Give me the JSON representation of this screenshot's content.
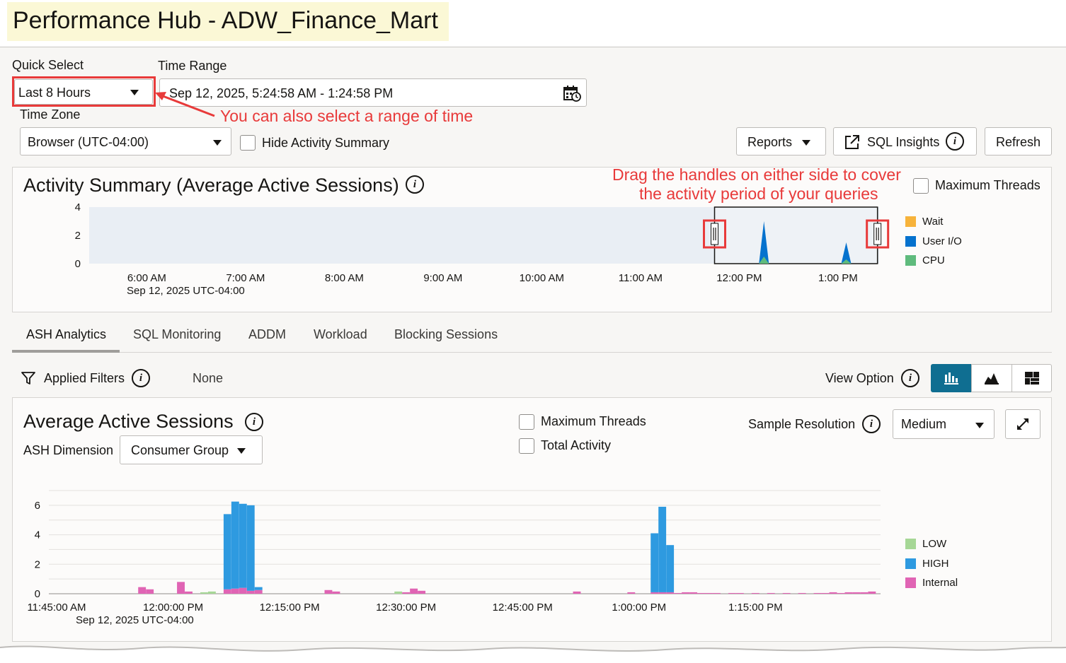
{
  "header": {
    "title": "Performance Hub - ADW_Finance_Mart"
  },
  "controls": {
    "quick_select_label": "Quick Select",
    "quick_select_value": "Last 8 Hours",
    "time_range_label": "Time Range",
    "time_range_value": "Sep 12, 2025, 5:24:58 AM - 1:24:58 PM",
    "time_zone_label": "Time Zone",
    "time_zone_value": "Browser (UTC-04:00)",
    "hide_activity_label": "Hide Activity Summary",
    "reports_label": "Reports",
    "sql_insights_label": "SQL Insights",
    "refresh_label": "Refresh"
  },
  "annotations": {
    "range_note": "You can also select a range of time",
    "drag_note_1": "Drag the handles on either side to cover",
    "drag_note_2": "the activity period of your queries"
  },
  "activity": {
    "title": "Activity Summary (Average Active Sessions)",
    "max_threads_label": "Maximum Threads",
    "date_label": "Sep 12, 2025 UTC-04:00",
    "legend": [
      {
        "name": "Wait",
        "color": "#f7b33b"
      },
      {
        "name": "User I/O",
        "color": "#0572ce"
      },
      {
        "name": "CPU",
        "color": "#5fbb7d"
      }
    ]
  },
  "tabs": [
    "ASH Analytics",
    "SQL Monitoring",
    "ADDM",
    "Workload",
    "Blocking Sessions"
  ],
  "filters": {
    "label": "Applied Filters",
    "value": "None",
    "view_option_label": "View Option"
  },
  "aas": {
    "title": "Average Active Sessions",
    "dimension_label": "ASH Dimension",
    "dimension_value": "Consumer Group",
    "max_threads_label": "Maximum Threads",
    "total_activity_label": "Total Activity",
    "sample_resolution_label": "Sample Resolution",
    "sample_resolution_value": "Medium",
    "date_label": "Sep 12, 2025 UTC-04:00"
  },
  "chart_data": [
    {
      "type": "area",
      "ylim": [
        0,
        4
      ],
      "yticks": [
        "0",
        "2",
        "4"
      ],
      "xticks": [
        "6:00 AM",
        "7:00 AM",
        "8:00 AM",
        "9:00 AM",
        "10:00 AM",
        "11:00 AM",
        "12:00 PM",
        "1:00 PM"
      ],
      "selection": [
        "11:45 AM",
        "1:24 PM"
      ],
      "series": [
        {
          "name": "Wait",
          "color": "#f7b33b",
          "x": [],
          "values": []
        },
        {
          "name": "User I/O",
          "color": "#0572ce",
          "x": [
            "12:15 PM",
            "1:05 PM"
          ],
          "values": [
            3.0,
            1.5
          ]
        },
        {
          "name": "CPU",
          "color": "#5fbb7d",
          "x": [
            "12:15 PM",
            "1:05 PM"
          ],
          "values": [
            0.5,
            0.3
          ]
        }
      ]
    },
    {
      "type": "bar",
      "stacked": true,
      "ylim": [
        0,
        7
      ],
      "yticks": [
        "0",
        "2",
        "4",
        "6"
      ],
      "xticks": [
        "11:45:00 AM",
        "12:00:00 PM",
        "12:15:00 PM",
        "12:30:00 PM",
        "12:45:00 PM",
        "1:00:00 PM",
        "1:15:00 PM"
      ],
      "x_minutes_from_1145": [
        11,
        12,
        16,
        17,
        19,
        20,
        22,
        23,
        24,
        25,
        26,
        27,
        35,
        36,
        44,
        45,
        46,
        47,
        67,
        74,
        77,
        78,
        79,
        80,
        81,
        82,
        83,
        84,
        85,
        87,
        88,
        90,
        92,
        94,
        96,
        98,
        99,
        100,
        101,
        102,
        103,
        104,
        105
      ],
      "series": [
        {
          "name": "LOW",
          "color": "#a6d796",
          "values": [
            0,
            0,
            0,
            0,
            0.1,
            0.15,
            0,
            0,
            0,
            0,
            0,
            0,
            0,
            0,
            0.15,
            0,
            0,
            0,
            0,
            0,
            0,
            0,
            0,
            0,
            0,
            0,
            0,
            0,
            0,
            0,
            0,
            0,
            0,
            0,
            0,
            0,
            0,
            0,
            0,
            0,
            0,
            0,
            0
          ]
        },
        {
          "name": "HIGH",
          "color": "#2e9ae0",
          "values": [
            0,
            0,
            0,
            0,
            0,
            0,
            5.1,
            5.9,
            5.7,
            5.8,
            0.2,
            0,
            0,
            0,
            0,
            0,
            0,
            0,
            0,
            0,
            4.0,
            5.8,
            3.2,
            0,
            0,
            0,
            0,
            0,
            0,
            0,
            0,
            0,
            0,
            0,
            0,
            0,
            0,
            0,
            0,
            0,
            0,
            0,
            0
          ]
        },
        {
          "name": "Internal",
          "color": "#e064b4",
          "values": [
            0.45,
            0.3,
            0.8,
            0.15,
            0,
            0,
            0.3,
            0.35,
            0.4,
            0.2,
            0.25,
            0,
            0.25,
            0.15,
            0,
            0.1,
            0.35,
            0.2,
            0.15,
            0.1,
            0.1,
            0.1,
            0.1,
            0.05,
            0.1,
            0.1,
            0.05,
            0.05,
            0.05,
            0.05,
            0.05,
            0.05,
            0.05,
            0.05,
            0.05,
            0.05,
            0.05,
            0.1,
            0.05,
            0.1,
            0.1,
            0.1,
            0.15
          ]
        }
      ]
    }
  ]
}
